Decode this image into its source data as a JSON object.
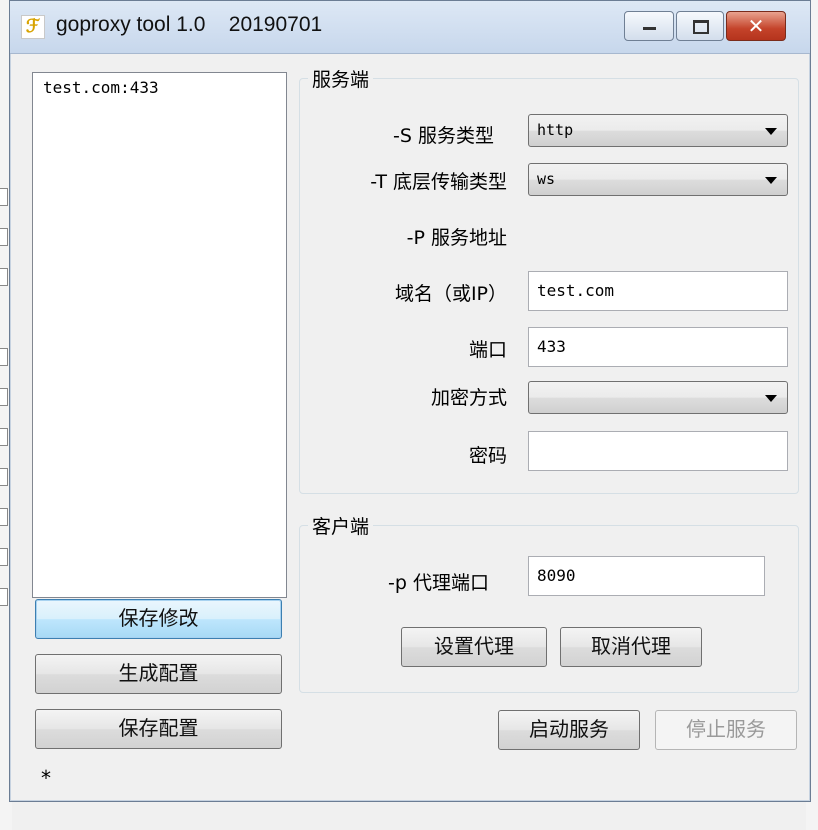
{
  "window": {
    "title": "goproxy tool 1.0    20190701",
    "icon": "app-icon"
  },
  "config_list": {
    "items": [
      "test.com:433"
    ]
  },
  "left_buttons": {
    "save_edit": "保存修改",
    "generate_config": "生成配置",
    "save_config": "保存配置"
  },
  "status_marker": "*",
  "server": {
    "group_label": "服务端",
    "service_type_label": "-S 服务类型",
    "service_type_value": "http",
    "transport_label": "-T 底层传输类型",
    "transport_value": "ws",
    "address_label": "-P 服务地址",
    "domain_label": "域名（或IP）",
    "domain_value": "test.com",
    "port_label": "端口",
    "port_value": "433",
    "encryption_label": "加密方式",
    "encryption_value": "",
    "password_label": "密码",
    "password_value": ""
  },
  "client": {
    "group_label": "客户端",
    "proxy_port_label": "-p 代理端口",
    "proxy_port_value": "8090",
    "set_proxy": "设置代理",
    "cancel_proxy": "取消代理"
  },
  "footer_buttons": {
    "start_service": "启动服务",
    "stop_service": "停止服务"
  }
}
